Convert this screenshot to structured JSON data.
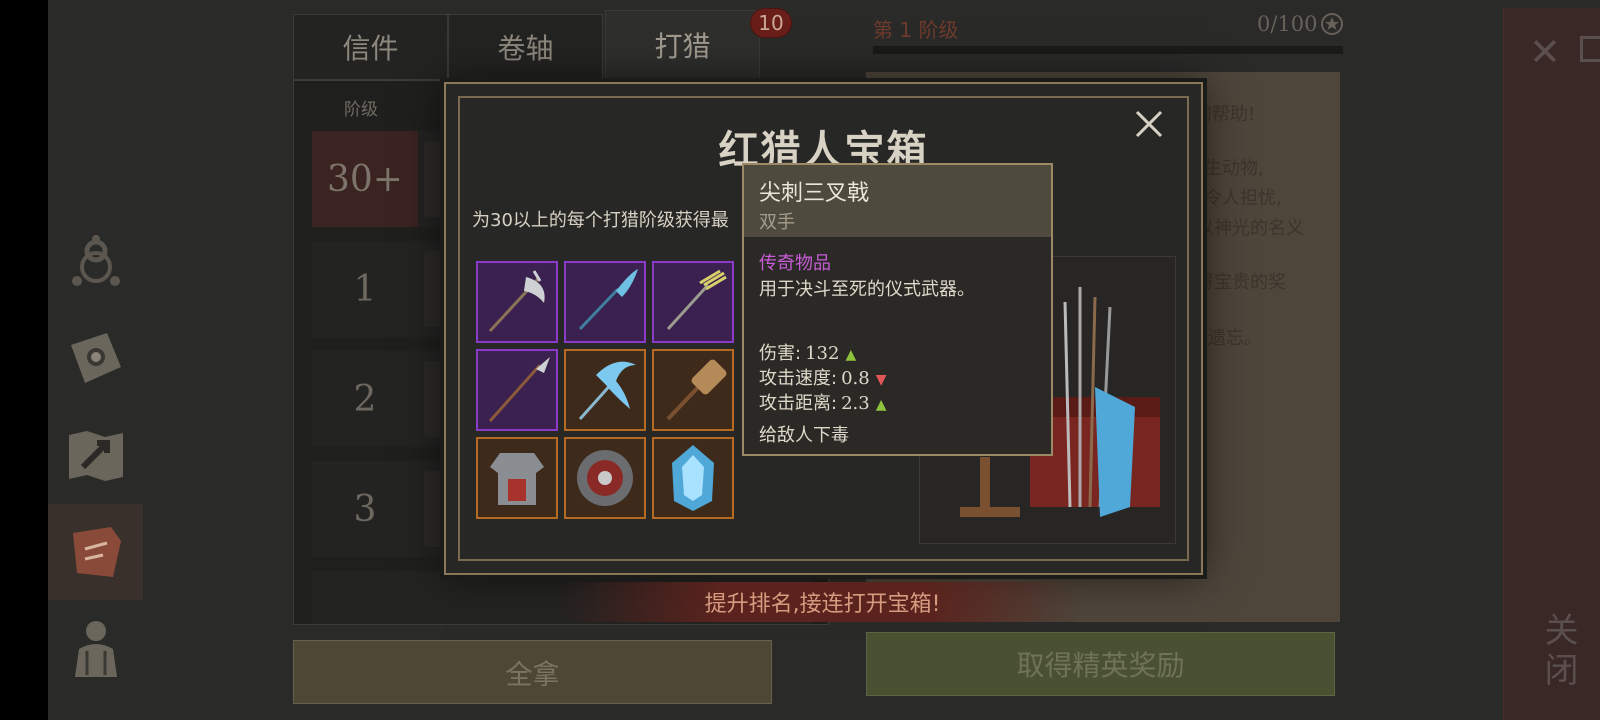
{
  "tabs": [
    {
      "label": "信件"
    },
    {
      "label": "卷轴"
    },
    {
      "label": "打猎"
    }
  ],
  "tab_badge": "10",
  "ladder": {
    "header": "阶级",
    "rows": [
      {
        "tier": "30+"
      },
      {
        "tier": "1"
      },
      {
        "tier": "2"
      },
      {
        "tier": "3"
      }
    ]
  },
  "stage": {
    "label": "第 1 阶级",
    "count": "0/100",
    "progress": 0
  },
  "parchment_lines": [
    "的帮助!",
    "野生动物,",
    "实令人担忧,",
    "以神光的名义",
    "得宝贵的奖",
    "被遗忘。"
  ],
  "buttons": {
    "collect_all": "全拿",
    "elite_reward": "取得精英奖励",
    "close_vertical": "关闭"
  },
  "modal": {
    "title": "红猎人宝箱",
    "description": "为30以上的每个打猎阶级获得最",
    "items": [
      {
        "icon": "halberd-axe-icon",
        "rarity": "purple"
      },
      {
        "icon": "glaive-icon",
        "rarity": "purple"
      },
      {
        "icon": "trident-icon",
        "rarity": "purple"
      },
      {
        "icon": "spear-icon",
        "rarity": "purple"
      },
      {
        "icon": "crescent-glaive-icon",
        "rarity": "orange"
      },
      {
        "icon": "warhammer-icon",
        "rarity": "orange"
      },
      {
        "icon": "plate-armor-icon",
        "rarity": "orange"
      },
      {
        "icon": "spiked-shield-icon",
        "rarity": "orange"
      },
      {
        "icon": "ice-crystal-helm-icon",
        "rarity": "orange"
      }
    ],
    "rank_banner": "提升排名,接连打开宝箱!"
  },
  "tooltip": {
    "name": "尖刺三叉戟",
    "subtitle": "双手",
    "rarity": "传奇物品",
    "description": "用于决斗至死的仪式武器。",
    "stats": [
      {
        "label": "伤害:",
        "value": "132",
        "trend": "up"
      },
      {
        "label": "攻击速度:",
        "value": "0.8",
        "trend": "down"
      },
      {
        "label": "攻击距离:",
        "value": "2.3",
        "trend": "up"
      }
    ],
    "effect": "给敌人下毒"
  },
  "colors": {
    "legendary_purple": "#c85bd6",
    "epic_orange": "#b66a23",
    "stat_up": "#8fc23d",
    "stat_down": "#e15656"
  }
}
